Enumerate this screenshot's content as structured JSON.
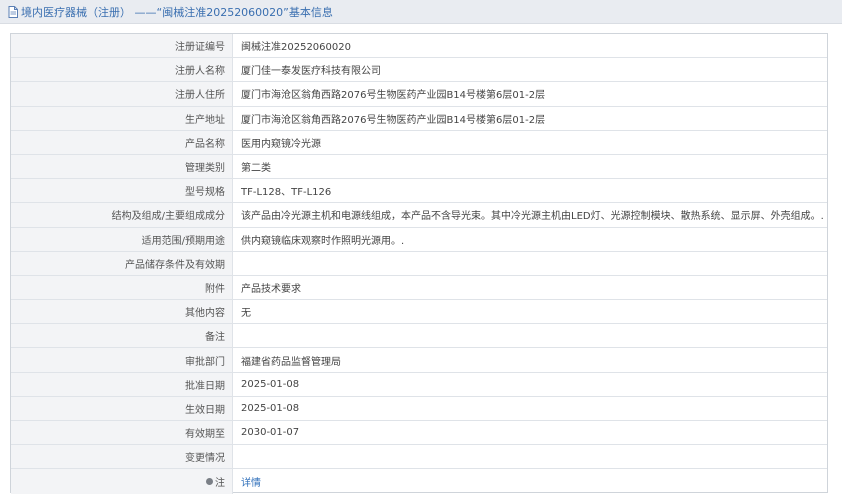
{
  "header": {
    "title": "境内医疗器械（注册） ——“闽械注准20252060020”基本信息"
  },
  "rows": [
    {
      "label": "注册证编号",
      "value": "闽械注准20252060020"
    },
    {
      "label": "注册人名称",
      "value": "厦门佳一泰发医疗科技有限公司"
    },
    {
      "label": "注册人住所",
      "value": "厦门市海沧区翁角西路2076号生物医药产业园B14号楼第6层01-2层"
    },
    {
      "label": "生产地址",
      "value": "厦门市海沧区翁角西路2076号生物医药产业园B14号楼第6层01-2层"
    },
    {
      "label": "产品名称",
      "value": "医用内窥镜冷光源"
    },
    {
      "label": "管理类别",
      "value": "第二类"
    },
    {
      "label": "型号规格",
      "value": "TF-L128、TF-L126"
    },
    {
      "label": "结构及组成/主要组成成分",
      "value": "该产品由冷光源主机和电源线组成，本产品不含导光束。其中冷光源主机由LED灯、光源控制模块、散热系统、显示屏、外壳组成。."
    },
    {
      "label": "适用范围/预期用途",
      "value": "供内窥镜临床观察时作照明光源用。."
    },
    {
      "label": "产品储存条件及有效期",
      "value": ""
    },
    {
      "label": "附件",
      "value": "产品技术要求"
    },
    {
      "label": "其他内容",
      "value": "无"
    },
    {
      "label": "备注",
      "value": ""
    },
    {
      "label": "审批部门",
      "value": "福建省药品监督管理局"
    },
    {
      "label": "批准日期",
      "value": "2025-01-08"
    },
    {
      "label": "生效日期",
      "value": "2025-01-08"
    },
    {
      "label": "有效期至",
      "value": "2030-01-07"
    },
    {
      "label": "变更情况",
      "value": ""
    },
    {
      "label": "注",
      "value": "详情"
    }
  ]
}
